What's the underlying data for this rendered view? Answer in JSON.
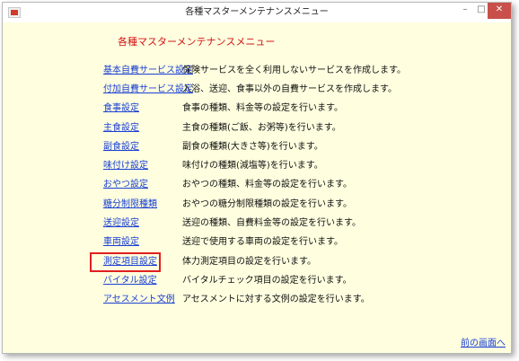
{
  "window": {
    "title": "各種マスターメンテナンスメニュー",
    "controls": {
      "minimize": "–",
      "maximize": "□",
      "close": "✕"
    }
  },
  "main": {
    "heading": "各種マスターメンテナンスメニュー",
    "items": [
      {
        "label": "基本自費サービス設定",
        "description": "保険サービスを全く利用しないサービスを作成します。"
      },
      {
        "label": "付加自費サービス設定",
        "description": "入浴、送迎、食事以外の自費サービスを作成します。"
      },
      {
        "label": "食事設定",
        "description": "食事の種類、料金等の設定を行います。"
      },
      {
        "label": "主食設定",
        "description": "主食の種類(ご飯、お粥等)を行います。"
      },
      {
        "label": "副食設定",
        "description": "副食の種類(大きさ等)を行います。"
      },
      {
        "label": "味付け設定",
        "description": "味付けの種類(減塩等)を行います。"
      },
      {
        "label": "おやつ設定",
        "description": "おやつの種類、料金等の設定を行います。"
      },
      {
        "label": "糖分制限種類",
        "description": "おやつの糖分制限種類の設定を行います。"
      },
      {
        "label": "送迎設定",
        "description": "送迎の種類、自費料金等の設定を行います。"
      },
      {
        "label": "車両設定",
        "description": "送迎で使用する車両の設定を行います。"
      },
      {
        "label": "測定項目設定",
        "description": "体力測定項目の設定を行います。"
      },
      {
        "label": "バイタル設定",
        "description": "バイタルチェック項目の設定を行います。"
      },
      {
        "label": "アセスメント文例",
        "description": "アセスメントに対する文例の設定を行います。"
      }
    ],
    "back_label": "前の画面へ"
  },
  "colors": {
    "background": "#ffffe0",
    "heading": "#d21414",
    "link": "#1a3fd3",
    "highlight": "#e02020"
  }
}
